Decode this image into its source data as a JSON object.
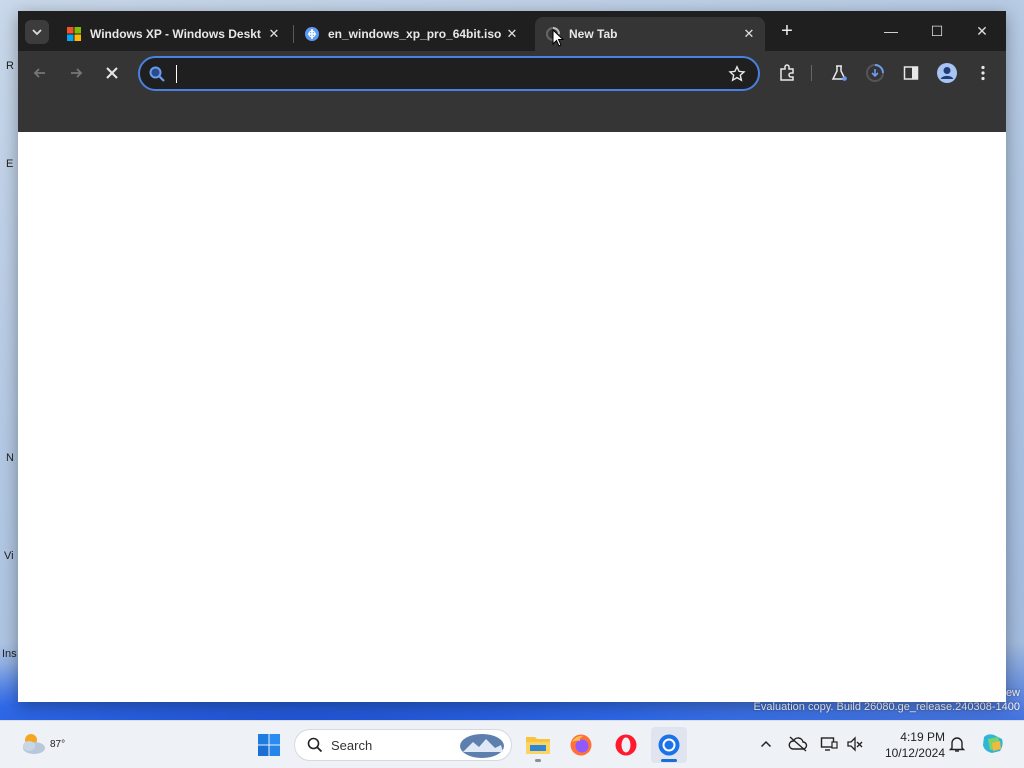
{
  "desktop": {
    "icon_letters": [
      "R",
      "E",
      "N",
      "Vi",
      "Ins"
    ],
    "watermark": "Evaluation copy. Build 26080.ge_release.240308-1400",
    "watermark_suffix": "ew"
  },
  "browser": {
    "tabs": [
      {
        "title": "Windows XP - Windows Deskt",
        "favicon": "windows-logo-icon",
        "close": "✕"
      },
      {
        "title": "en_windows_xp_pro_64bit.iso",
        "favicon": "globe-icon",
        "close": "✕"
      },
      {
        "title": "New Tab",
        "favicon": "loading-spinner-icon",
        "close": "✕",
        "active": true
      }
    ],
    "new_tab_label": "+",
    "window_controls": {
      "minimize": "—",
      "maximize": "☐",
      "close": "✕"
    },
    "toolbar": {
      "back_icon": "back-arrow-icon",
      "forward_icon": "forward-arrow-icon",
      "stop_icon": "stop-icon",
      "omnibox_value": "",
      "omnibox_placeholder": ""
    },
    "accent": "#4a80e0"
  },
  "taskbar": {
    "weather_temp": "87°",
    "search_label": "Search",
    "apps": [
      "start",
      "file-explorer",
      "firefox",
      "opera",
      "chrome"
    ],
    "clock_time": "4:19 PM",
    "clock_date": "10/12/2024"
  }
}
